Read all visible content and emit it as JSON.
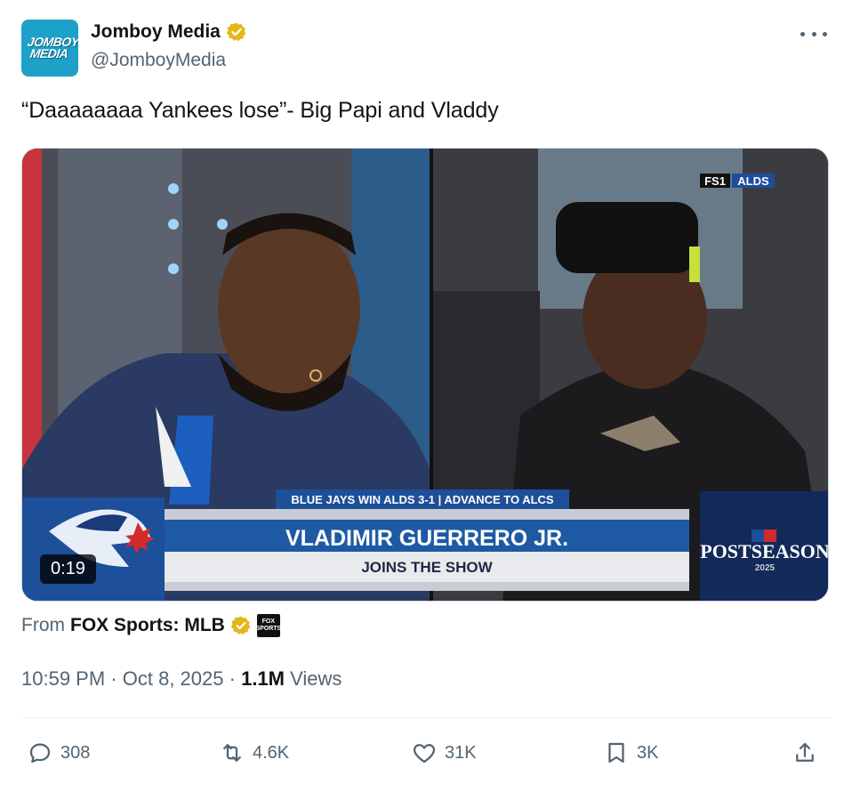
{
  "author": {
    "name": "Jomboy Media",
    "handle": "@JomboyMedia",
    "avatar_text": "JOMBOY MEDIA",
    "verified_color": "#e2b719"
  },
  "tweet": {
    "text": "“Daaaaaaaa Yankees lose”- Big Papi and Vladdy"
  },
  "video": {
    "duration": "0:19",
    "network_bug": "FS1",
    "series_bug": "ALDS",
    "ticker": "BLUE JAYS WIN ALDS 3-1 | ADVANCE TO ALCS",
    "lower_third_name": "VLADIMIR GUERRERO JR.",
    "lower_third_sub": "JOINS THE SHOW",
    "postseason_logo": "POSTSEASON",
    "postseason_year": "2025"
  },
  "source": {
    "prefix": "From",
    "name": "FOX Sports: MLB",
    "logo_text": "FOX SPORTS"
  },
  "meta": {
    "time": "10:59 PM",
    "date": "Oct 8, 2025",
    "views_count": "1.1M",
    "views_label": "Views"
  },
  "actions": {
    "replies": "308",
    "reposts": "4.6K",
    "likes": "31K",
    "bookmarks": "3K"
  },
  "colors": {
    "text_primary": "#0f1419",
    "text_secondary": "#536471",
    "avatar_bg": "#1da1c9"
  }
}
